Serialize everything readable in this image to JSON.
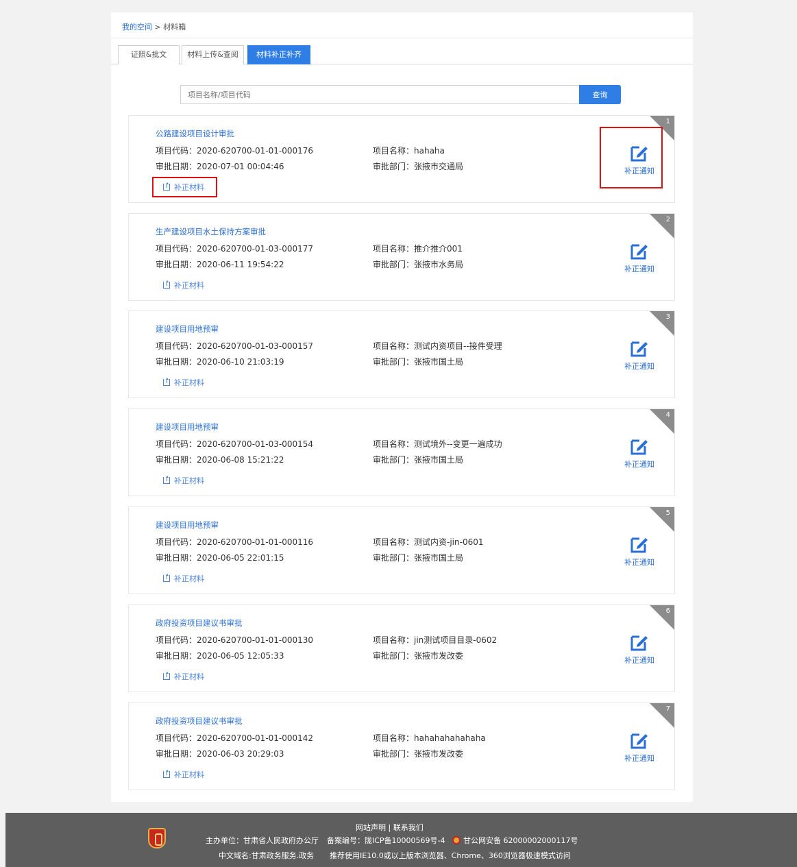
{
  "breadcrumb": {
    "home": "我的空间",
    "separator": " > ",
    "current": "材料箱"
  },
  "tabs": [
    {
      "label": "证照&批文",
      "active": false
    },
    {
      "label": "材料上传&查阅",
      "active": false
    },
    {
      "label": "材料补正补齐",
      "active": true
    }
  ],
  "search": {
    "placeholder": "项目名称/项目代码",
    "button": "查询"
  },
  "labels": {
    "code": "项目代码：",
    "date": "审批日期：",
    "name": "项目名称：",
    "dept": "审批部门：",
    "upload": "补正材料",
    "notice": "补正通知"
  },
  "items": [
    {
      "num": "1",
      "title": "公路建设项目设计审批",
      "code": "2020-620700-01-01-000176",
      "date": "2020-07-01 00:04:46",
      "name": "hahaha",
      "dept": "张掖市交通局"
    },
    {
      "num": "2",
      "title": "生产建设项目水土保持方案审批",
      "code": "2020-620700-01-03-000177",
      "date": "2020-06-11 19:54:22",
      "name": "推介推介001",
      "dept": "张掖市水务局"
    },
    {
      "num": "3",
      "title": "建设项目用地预审",
      "code": "2020-620700-01-03-000157",
      "date": "2020-06-10 21:03:19",
      "name": "测试内资项目--接件受理",
      "dept": "张掖市国土局"
    },
    {
      "num": "4",
      "title": "建设项目用地预审",
      "code": "2020-620700-01-03-000154",
      "date": "2020-06-08 15:21:22",
      "name": "测试境外--变更一遍成功",
      "dept": "张掖市国土局"
    },
    {
      "num": "5",
      "title": "建设项目用地预审",
      "code": "2020-620700-01-01-000116",
      "date": "2020-06-05 22:01:15",
      "name": "测试内资-jin-0601",
      "dept": "张掖市国土局"
    },
    {
      "num": "6",
      "title": "政府投资项目建议书审批",
      "code": "2020-620700-01-01-000130",
      "date": "2020-06-05 12:05:33",
      "name": "jin测试项目目录-0602",
      "dept": "张掖市发改委"
    },
    {
      "num": "7",
      "title": "政府投资项目建议书审批",
      "code": "2020-620700-01-01-000142",
      "date": "2020-06-03 20:29:03",
      "name": "hahahahahahaha",
      "dept": "张掖市发改委"
    }
  ],
  "footer": {
    "links": "网站声明 | 联系我们",
    "host": "主办单位：甘肃省人民政府办公厅",
    "icp": "备案编号：陇ICP备10000569号-4",
    "police": "甘公网安备 62000002000117号",
    "domain": "中文域名:甘肃政务服务.政务",
    "browser": "推荐使用IE10.0或以上版本浏览器、Chrome、360浏览器极速模式访问"
  },
  "colors": {
    "accent": "#2f7ee6",
    "highlight": "#e01010",
    "footer_bg": "#5e5e5e"
  }
}
